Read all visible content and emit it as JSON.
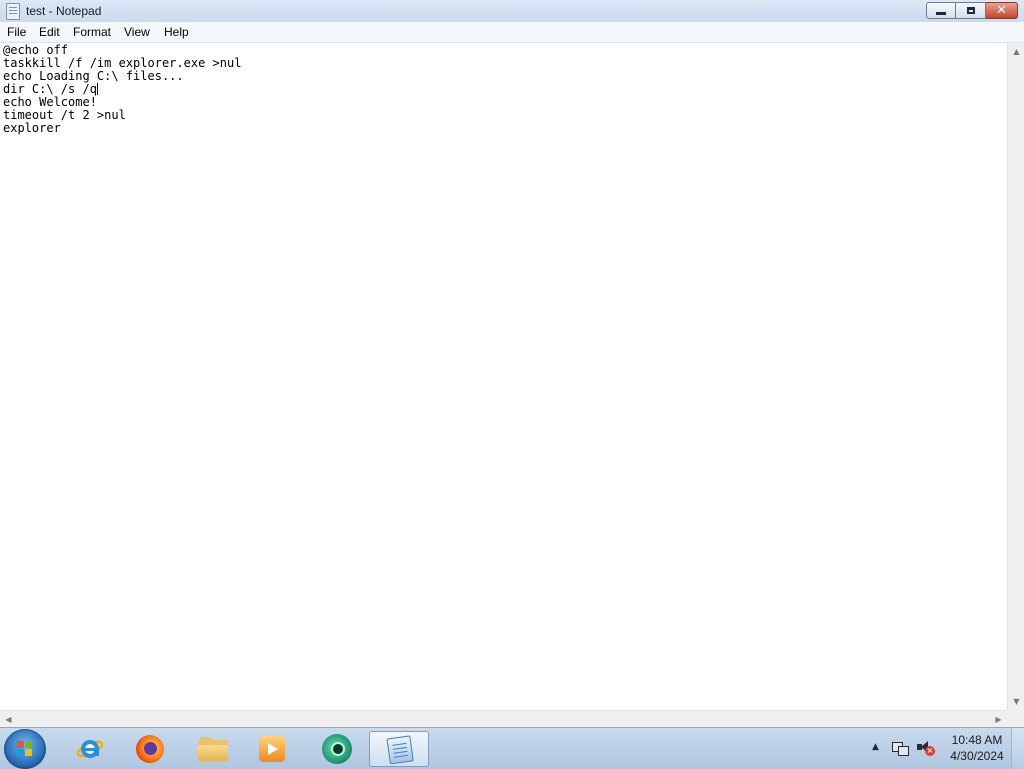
{
  "window": {
    "title": "test - Notepad",
    "close_glyph": "✕"
  },
  "menu": {
    "items": [
      "File",
      "Edit",
      "Format",
      "View",
      "Help"
    ]
  },
  "editor": {
    "lines": [
      "@echo off",
      "taskkill /f /im explorer.exe >nul",
      "echo Loading C:\\ files...",
      "dir C:\\ /s /q",
      "echo Welcome!",
      "timeout /t 2 >nul",
      "explorer"
    ]
  },
  "scrollbars": {
    "up_arrow": "▲",
    "down_arrow": "▼",
    "left_arrow": "◀",
    "right_arrow": "▶"
  },
  "taskbar": {
    "pinned": [
      "internet-explorer-icon",
      "firefox-icon",
      "file-explorer-icon",
      "media-player-icon",
      "green-app-icon",
      "notepad-icon"
    ],
    "active_item": "notepad-icon"
  },
  "tray": {
    "arrow": "▲",
    "volume_muted_mark": "×",
    "time": "10:48 AM",
    "date": "4/30/2024"
  },
  "colors": {
    "titlebar": "#c9dbef",
    "close_button": "#c7442d",
    "taskbar": "#aec6df"
  }
}
